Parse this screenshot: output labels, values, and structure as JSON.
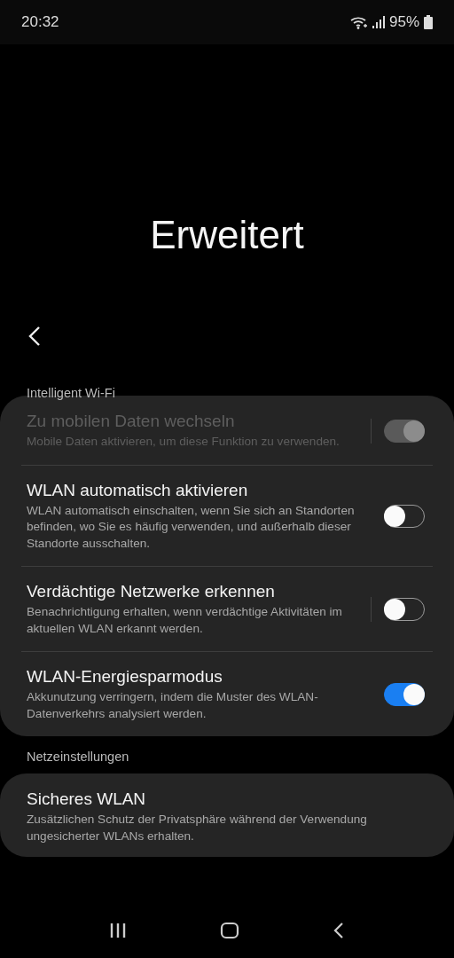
{
  "status_bar": {
    "time": "20:32",
    "battery": "95%"
  },
  "title": "Erweitert",
  "sections": [
    {
      "header": "Intelligent Wi-Fi",
      "items": [
        {
          "title": "Zu mobilen Daten wechseln",
          "description": "Mobile Daten aktivieren, um diese Funktion zu verwenden.",
          "on": true,
          "disabled": true,
          "divider": true
        },
        {
          "title": "WLAN automatisch aktivieren",
          "description": "WLAN automatisch einschalten, wenn Sie sich an Standorten befinden, wo Sie es häufig verwenden, und außerhalb dieser Standorte ausschalten.",
          "on": false,
          "disabled": false,
          "divider": false
        },
        {
          "title": "Verdächtige Netzwerke erkennen",
          "description": "Benachrichtigung erhalten, wenn verdächtige Aktivitäten im aktuellen WLAN erkannt werden.",
          "on": false,
          "disabled": false,
          "divider": true
        },
        {
          "title": "WLAN-Energiesparmodus",
          "description": "Akkunutzung verringern, indem die Muster des WLAN-Datenverkehrs analysiert werden.",
          "on": true,
          "disabled": false,
          "divider": false
        }
      ]
    },
    {
      "header": "Netzeinstellungen",
      "items": [
        {
          "title": "Sicheres WLAN",
          "description": "Zusätzlichen Schutz der Privatsphäre während der Verwendung ungesicherter WLANs erhalten."
        }
      ]
    }
  ]
}
